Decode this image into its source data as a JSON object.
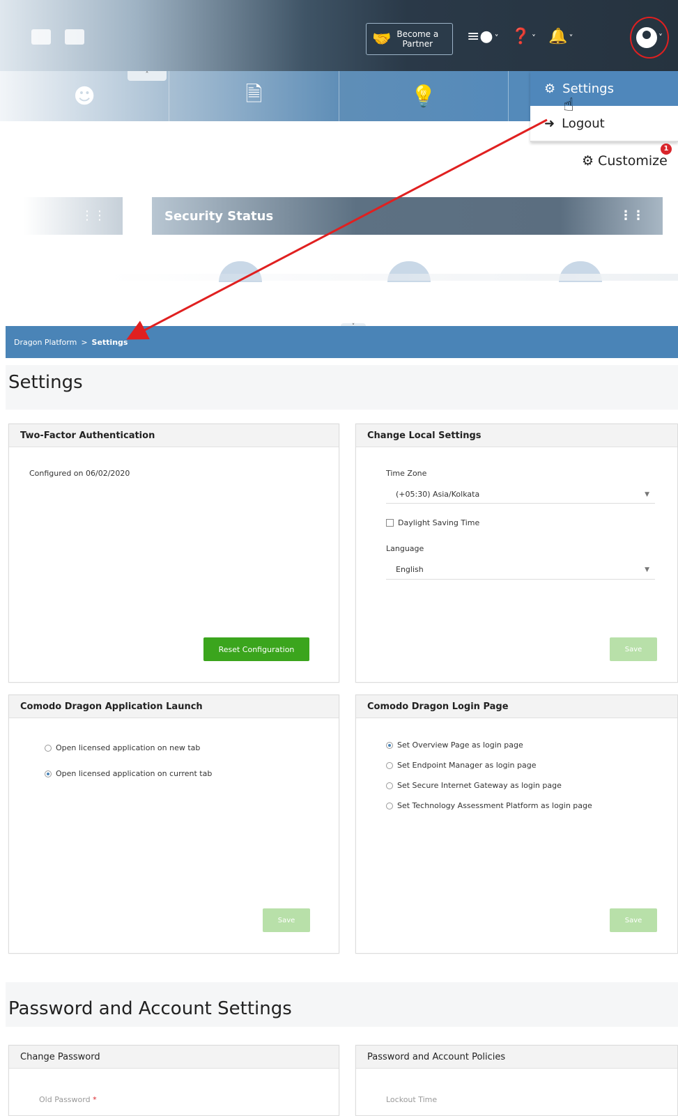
{
  "header": {
    "partner_line1": "Become a",
    "partner_line2": "Partner",
    "icons": [
      "cart-icon",
      "briefcase-icon",
      "handshake-icon",
      "list-clock-icon",
      "help-icon",
      "bell-icon",
      "user-avatar-icon"
    ]
  },
  "quick_nav": {
    "icons": [
      "user-icon",
      "file-download-icon",
      "lightbulb-icon"
    ]
  },
  "user_menu": {
    "settings_label": "Settings",
    "logout_label": "Logout"
  },
  "customize": {
    "label": "Customize",
    "badge": "1"
  },
  "widgets": {
    "security_status_title": "Security Status"
  },
  "breadcrumb": {
    "root": "Dragon Platform",
    "separator": ">",
    "current": "Settings"
  },
  "page": {
    "title": "Settings",
    "section2_title": "Password and Account Settings"
  },
  "two_factor": {
    "title": "Two-Factor Authentication",
    "status": "Configured on 06/02/2020",
    "reset_button": "Reset Configuration"
  },
  "local_settings": {
    "title": "Change Local Settings",
    "timezone_label": "Time Zone",
    "timezone_value": "(+05:30) Asia/Kolkata",
    "dst_label": "Daylight Saving Time",
    "language_label": "Language",
    "language_value": "English",
    "save_button": "Save"
  },
  "app_launch": {
    "title": "Comodo Dragon Application Launch",
    "options": [
      "Open licensed application on new tab",
      "Open licensed application on current tab"
    ],
    "selected_index": 1,
    "save_button": "Save"
  },
  "login_page": {
    "title": "Comodo Dragon Login Page",
    "options": [
      "Set Overview Page as login page",
      "Set Endpoint Manager as login page",
      "Set Secure Internet Gateway as login page",
      "Set Technology Assessment Platform as login page"
    ],
    "selected_index": 0,
    "save_button": "Save"
  },
  "change_password": {
    "title": "Change Password",
    "old_password_label": "Old Password",
    "required_mark": "*"
  },
  "account_policies": {
    "title": "Password and Account Policies",
    "lockout_label": "Lockout Time"
  },
  "colors": {
    "accent_blue": "#4a84b7",
    "green": "#3ba51d",
    "annotation_red": "#e02020"
  }
}
